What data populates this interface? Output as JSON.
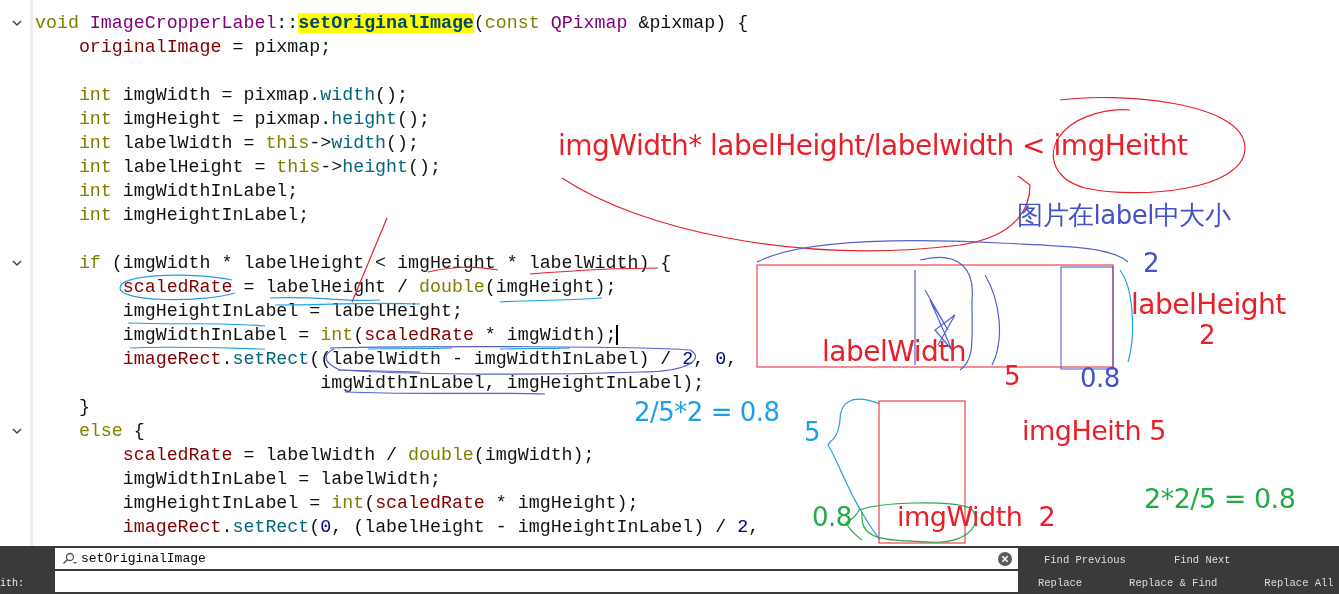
{
  "editor": {
    "lines": [
      {
        "fold": true,
        "tokens": [
          {
            "kind": "kw",
            "text": "void "
          },
          {
            "kind": "type",
            "text": "ImageCropperLabel"
          },
          {
            "kind": "plain",
            "text": "::"
          },
          {
            "kind": "match",
            "text": "setOriginalImage"
          },
          {
            "kind": "plain",
            "text": "("
          },
          {
            "kind": "kw",
            "text": "const "
          },
          {
            "kind": "type",
            "text": "QPixmap"
          },
          {
            "kind": "plain",
            "text": " &pixmap) {"
          }
        ]
      },
      {
        "fold": false,
        "tokens": [
          {
            "kind": "member",
            "text": "    originalImage"
          },
          {
            "kind": "plain",
            "text": " = pixmap;"
          }
        ]
      },
      {
        "fold": false
      },
      {
        "fold": false,
        "tokens": [
          {
            "kind": "kw",
            "text": "    int"
          },
          {
            "kind": "plain",
            "text": " imgWidth = pixmap."
          },
          {
            "kind": "func",
            "text": "width"
          },
          {
            "kind": "plain",
            "text": "();"
          }
        ]
      },
      {
        "fold": false,
        "tokens": [
          {
            "kind": "kw",
            "text": "    int"
          },
          {
            "kind": "plain",
            "text": " imgHeight = pixmap."
          },
          {
            "kind": "func",
            "text": "height"
          },
          {
            "kind": "plain",
            "text": "();"
          }
        ]
      },
      {
        "fold": false,
        "tokens": [
          {
            "kind": "kw",
            "text": "    int"
          },
          {
            "kind": "plain",
            "text": " labelWidth = "
          },
          {
            "kind": "kw",
            "text": "this"
          },
          {
            "kind": "plain",
            "text": "->"
          },
          {
            "kind": "func",
            "text": "width"
          },
          {
            "kind": "plain",
            "text": "();"
          }
        ]
      },
      {
        "fold": false,
        "tokens": [
          {
            "kind": "kw",
            "text": "    int"
          },
          {
            "kind": "plain",
            "text": " labelHeight = "
          },
          {
            "kind": "kw",
            "text": "this"
          },
          {
            "kind": "plain",
            "text": "->"
          },
          {
            "kind": "func",
            "text": "height"
          },
          {
            "kind": "plain",
            "text": "();"
          }
        ]
      },
      {
        "fold": false,
        "tokens": [
          {
            "kind": "kw",
            "text": "    int"
          },
          {
            "kind": "plain",
            "text": " imgWidthInLabel;"
          }
        ]
      },
      {
        "fold": false,
        "tokens": [
          {
            "kind": "kw",
            "text": "    int"
          },
          {
            "kind": "plain",
            "text": " imgHeightInLabel;"
          }
        ]
      },
      {
        "fold": false
      },
      {
        "fold": true,
        "tokens": [
          {
            "kind": "kw",
            "text": "    if"
          },
          {
            "kind": "plain",
            "text": " (imgWidth * labelHeight < imgHeight * labelWidth) {"
          }
        ]
      },
      {
        "fold": false,
        "tokens": [
          {
            "kind": "member",
            "text": "        scaledRate"
          },
          {
            "kind": "plain",
            "text": " = labelHeight / "
          },
          {
            "kind": "kw",
            "text": "double"
          },
          {
            "kind": "plain",
            "text": "(imgHeight);"
          }
        ]
      },
      {
        "fold": false,
        "tokens": [
          {
            "kind": "plain",
            "text": "        imgHeightInLabel = labelHeight;"
          }
        ]
      },
      {
        "fold": false,
        "caret": true,
        "tokens": [
          {
            "kind": "plain",
            "text": "        imgWidthInLabel = "
          },
          {
            "kind": "kw",
            "text": "int"
          },
          {
            "kind": "plain",
            "text": "("
          },
          {
            "kind": "member",
            "text": "scaledRate"
          },
          {
            "kind": "plain",
            "text": " * imgWidth);"
          }
        ]
      },
      {
        "fold": false,
        "tokens": [
          {
            "kind": "member",
            "text": "        imageRect"
          },
          {
            "kind": "plain",
            "text": "."
          },
          {
            "kind": "func",
            "text": "setRect"
          },
          {
            "kind": "plain",
            "text": "((labelWidth - imgWidthInLabel) / "
          },
          {
            "kind": "num",
            "text": "2"
          },
          {
            "kind": "plain",
            "text": ", "
          },
          {
            "kind": "num",
            "text": "0"
          },
          {
            "kind": "plain",
            "text": ","
          }
        ]
      },
      {
        "fold": false,
        "tokens": [
          {
            "kind": "plain",
            "text": "                          imgWidthInLabel, imgHeightInLabel);"
          }
        ]
      },
      {
        "fold": false,
        "tokens": [
          {
            "kind": "plain",
            "text": "    }"
          }
        ]
      },
      {
        "fold": true,
        "tokens": [
          {
            "kind": "kw",
            "text": "    else"
          },
          {
            "kind": "plain",
            "text": " {"
          }
        ]
      },
      {
        "fold": false,
        "tokens": [
          {
            "kind": "member",
            "text": "        scaledRate"
          },
          {
            "kind": "plain",
            "text": " = labelWidth / "
          },
          {
            "kind": "kw",
            "text": "double"
          },
          {
            "kind": "plain",
            "text": "(imgWidth);"
          }
        ]
      },
      {
        "fold": false,
        "tokens": [
          {
            "kind": "plain",
            "text": "        imgWidthInLabel = labelWidth;"
          }
        ]
      },
      {
        "fold": false,
        "tokens": [
          {
            "kind": "plain",
            "text": "        imgHeightInLabel = "
          },
          {
            "kind": "kw",
            "text": "int"
          },
          {
            "kind": "plain",
            "text": "("
          },
          {
            "kind": "member",
            "text": "scaledRate"
          },
          {
            "kind": "plain",
            "text": " * imgHeight);"
          }
        ]
      },
      {
        "fold": false,
        "tokens": [
          {
            "kind": "member",
            "text": "        imageRect"
          },
          {
            "kind": "plain",
            "text": "."
          },
          {
            "kind": "func",
            "text": "setRect"
          },
          {
            "kind": "plain",
            "text": "("
          },
          {
            "kind": "num",
            "text": "0"
          },
          {
            "kind": "plain",
            "text": ", (labelHeight - imgHeightInLabel) / "
          },
          {
            "kind": "num",
            "text": "2"
          },
          {
            "kind": "plain",
            "text": ","
          }
        ]
      }
    ]
  },
  "annotations": [
    {
      "text": "imgWidth* labelHeight/labelwidth < imgHeitht",
      "color": "#e8202a"
    },
    {
      "text": "图片在label中大小",
      "color": "#4452c8"
    },
    {
      "text": "2",
      "color": "#4452c8"
    },
    {
      "text": "labelHeight",
      "color": "#e8202a"
    },
    {
      "text": "2",
      "color": "#e8202a"
    },
    {
      "text": "labelWidth",
      "color": "#e8202a"
    },
    {
      "text": "5",
      "color": "#e8202a"
    },
    {
      "text": "0.8",
      "color": "#4452c8"
    },
    {
      "text": "2/5*2 = 0.8",
      "color": "#1ea0e6"
    },
    {
      "text": "5",
      "color": "#1ea0e6"
    },
    {
      "text": "imgHeith 5",
      "color": "#e8202a"
    },
    {
      "text": "0.8",
      "color": "#22aa44"
    },
    {
      "text": "imgWidth  2",
      "color": "#e8202a"
    },
    {
      "text": "2*2/5 = 0.8",
      "color": "#22aa44"
    }
  ],
  "find_bar": {
    "replace_label": "ith:",
    "find_field": {
      "value": "setOriginalImage"
    },
    "buttons": [
      {
        "label": "Find Previous"
      },
      {
        "label": "Find Next"
      },
      {
        "label": "Replace"
      },
      {
        "label": "Replace & Find"
      },
      {
        "label": "Replace All"
      }
    ]
  }
}
